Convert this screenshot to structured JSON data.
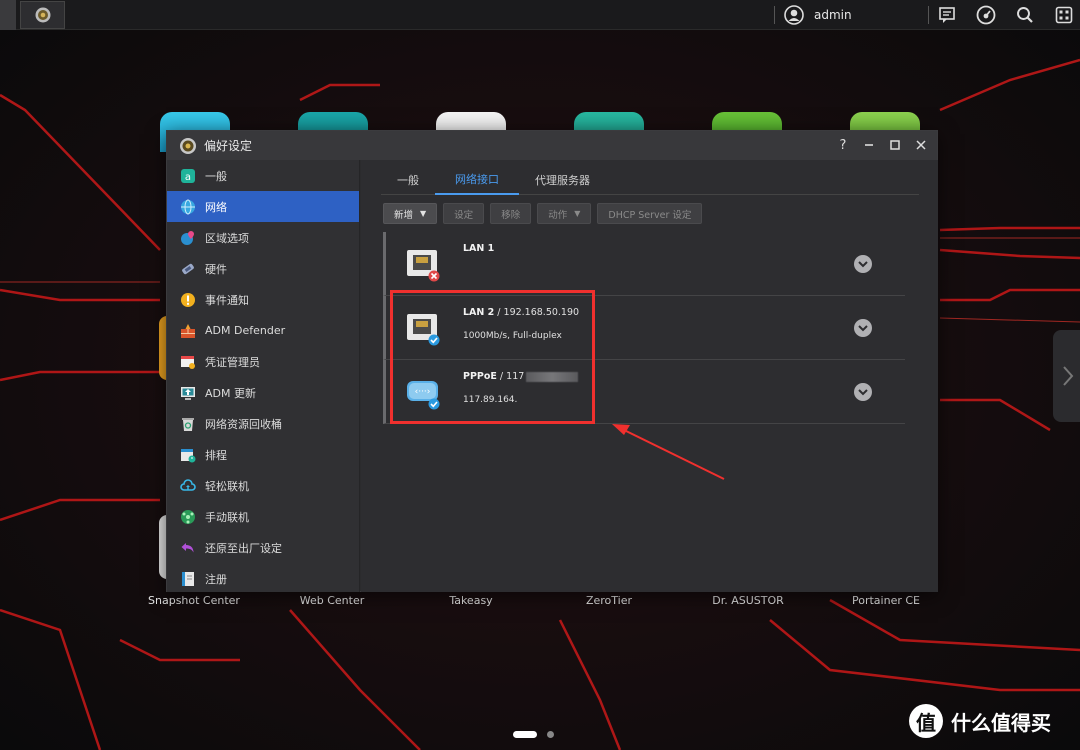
{
  "topbar": {
    "user_name": "admin",
    "icons": [
      "home-settings-icon",
      "user-avatar-icon",
      "message-icon",
      "dashboard-icon",
      "search-icon",
      "apps-icon"
    ]
  },
  "desktop": {
    "apps": [
      "Snapshot Center",
      "Web Center",
      "Takeasy",
      "ZeroTier",
      "Dr. ASUSTOR",
      "Portainer CE"
    ],
    "pager": {
      "pages": 2,
      "current": 1
    }
  },
  "window": {
    "title": "偏好设定",
    "sidebar": [
      {
        "label": "一般",
        "icon": "general-icon"
      },
      {
        "label": "网络",
        "icon": "globe-icon",
        "active": true
      },
      {
        "label": "区域选项",
        "icon": "region-icon"
      },
      {
        "label": "硬件",
        "icon": "hardware-icon"
      },
      {
        "label": "事件通知",
        "icon": "alert-icon"
      },
      {
        "label": "ADM Defender",
        "icon": "firewall-icon"
      },
      {
        "label": "凭证管理员",
        "icon": "certificate-icon"
      },
      {
        "label": "ADM 更新",
        "icon": "update-icon"
      },
      {
        "label": "网络资源回收桶",
        "icon": "recycle-bin-icon"
      },
      {
        "label": "排程",
        "icon": "schedule-icon"
      },
      {
        "label": "轻松联机",
        "icon": "cloud-connect-icon"
      },
      {
        "label": "手动联机",
        "icon": "manual-connect-icon"
      },
      {
        "label": "还原至出厂设定",
        "icon": "restore-icon"
      },
      {
        "label": "注册",
        "icon": "register-icon"
      }
    ],
    "tabs": [
      "一般",
      "网络接口",
      "代理服务器"
    ],
    "active_tab": 1,
    "toolbar": {
      "add": "新增",
      "settings": "设定",
      "remove": "移除",
      "action": "动作",
      "dhcp": "DHCP Server 设定"
    },
    "interfaces": [
      {
        "name": "LAN 1",
        "address": "",
        "detail": "",
        "status": "disconnected",
        "type": "ethernet"
      },
      {
        "name": "LAN 2",
        "address": " / 192.168.50.190",
        "detail": "1000Mb/s, Full-duplex",
        "status": "connected",
        "type": "ethernet"
      },
      {
        "name": "PPPoE",
        "address": " / 117",
        "detail": "117.89.164.",
        "status": "connected",
        "type": "pppoe"
      }
    ]
  },
  "watermark": {
    "badge": "值",
    "text": "什么值得买"
  },
  "colors": {
    "accent": "#2e61c4",
    "tab_active": "#4a9bef",
    "annotation": "#f0302e"
  }
}
